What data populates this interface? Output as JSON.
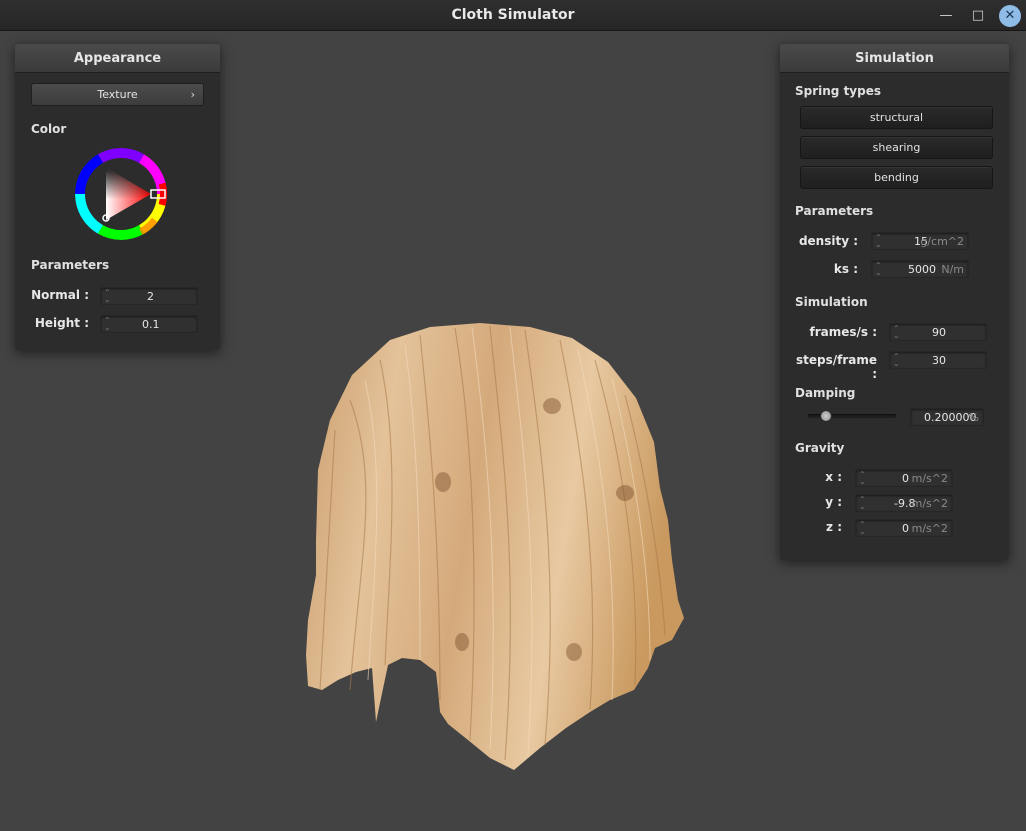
{
  "window": {
    "title": "Cloth Simulator"
  },
  "appearance": {
    "title": "Appearance",
    "texture_button": "Texture",
    "color_label": "Color",
    "color_value": "#ff0000",
    "parameters_label": "Parameters",
    "normal": {
      "label": "Normal :",
      "value": "2"
    },
    "height": {
      "label": "Height :",
      "value": "0.1"
    }
  },
  "simulation": {
    "title": "Simulation",
    "spring_types_label": "Spring types",
    "springs": [
      "structural",
      "shearing",
      "bending"
    ],
    "parameters_label": "Parameters",
    "density": {
      "label": "density :",
      "value": "15",
      "unit": "g/cm^2"
    },
    "ks": {
      "label": "ks :",
      "value": "5000",
      "unit": "N/m"
    },
    "simulation_label": "Simulation",
    "fps": {
      "label": "frames/s :",
      "value": "90"
    },
    "steps": {
      "label": "steps/frame :",
      "value": "30"
    },
    "damping_label": "Damping",
    "damping": {
      "value": "0.200000",
      "unit": "%",
      "fraction": 0.2
    },
    "gravity_label": "Gravity",
    "gx": {
      "label": "x :",
      "value": "0",
      "unit": "m/s^2"
    },
    "gy": {
      "label": "y :",
      "value": "-9.8",
      "unit": "m/s^2"
    },
    "gz": {
      "label": "z :",
      "value": "0",
      "unit": "m/s^2"
    }
  }
}
